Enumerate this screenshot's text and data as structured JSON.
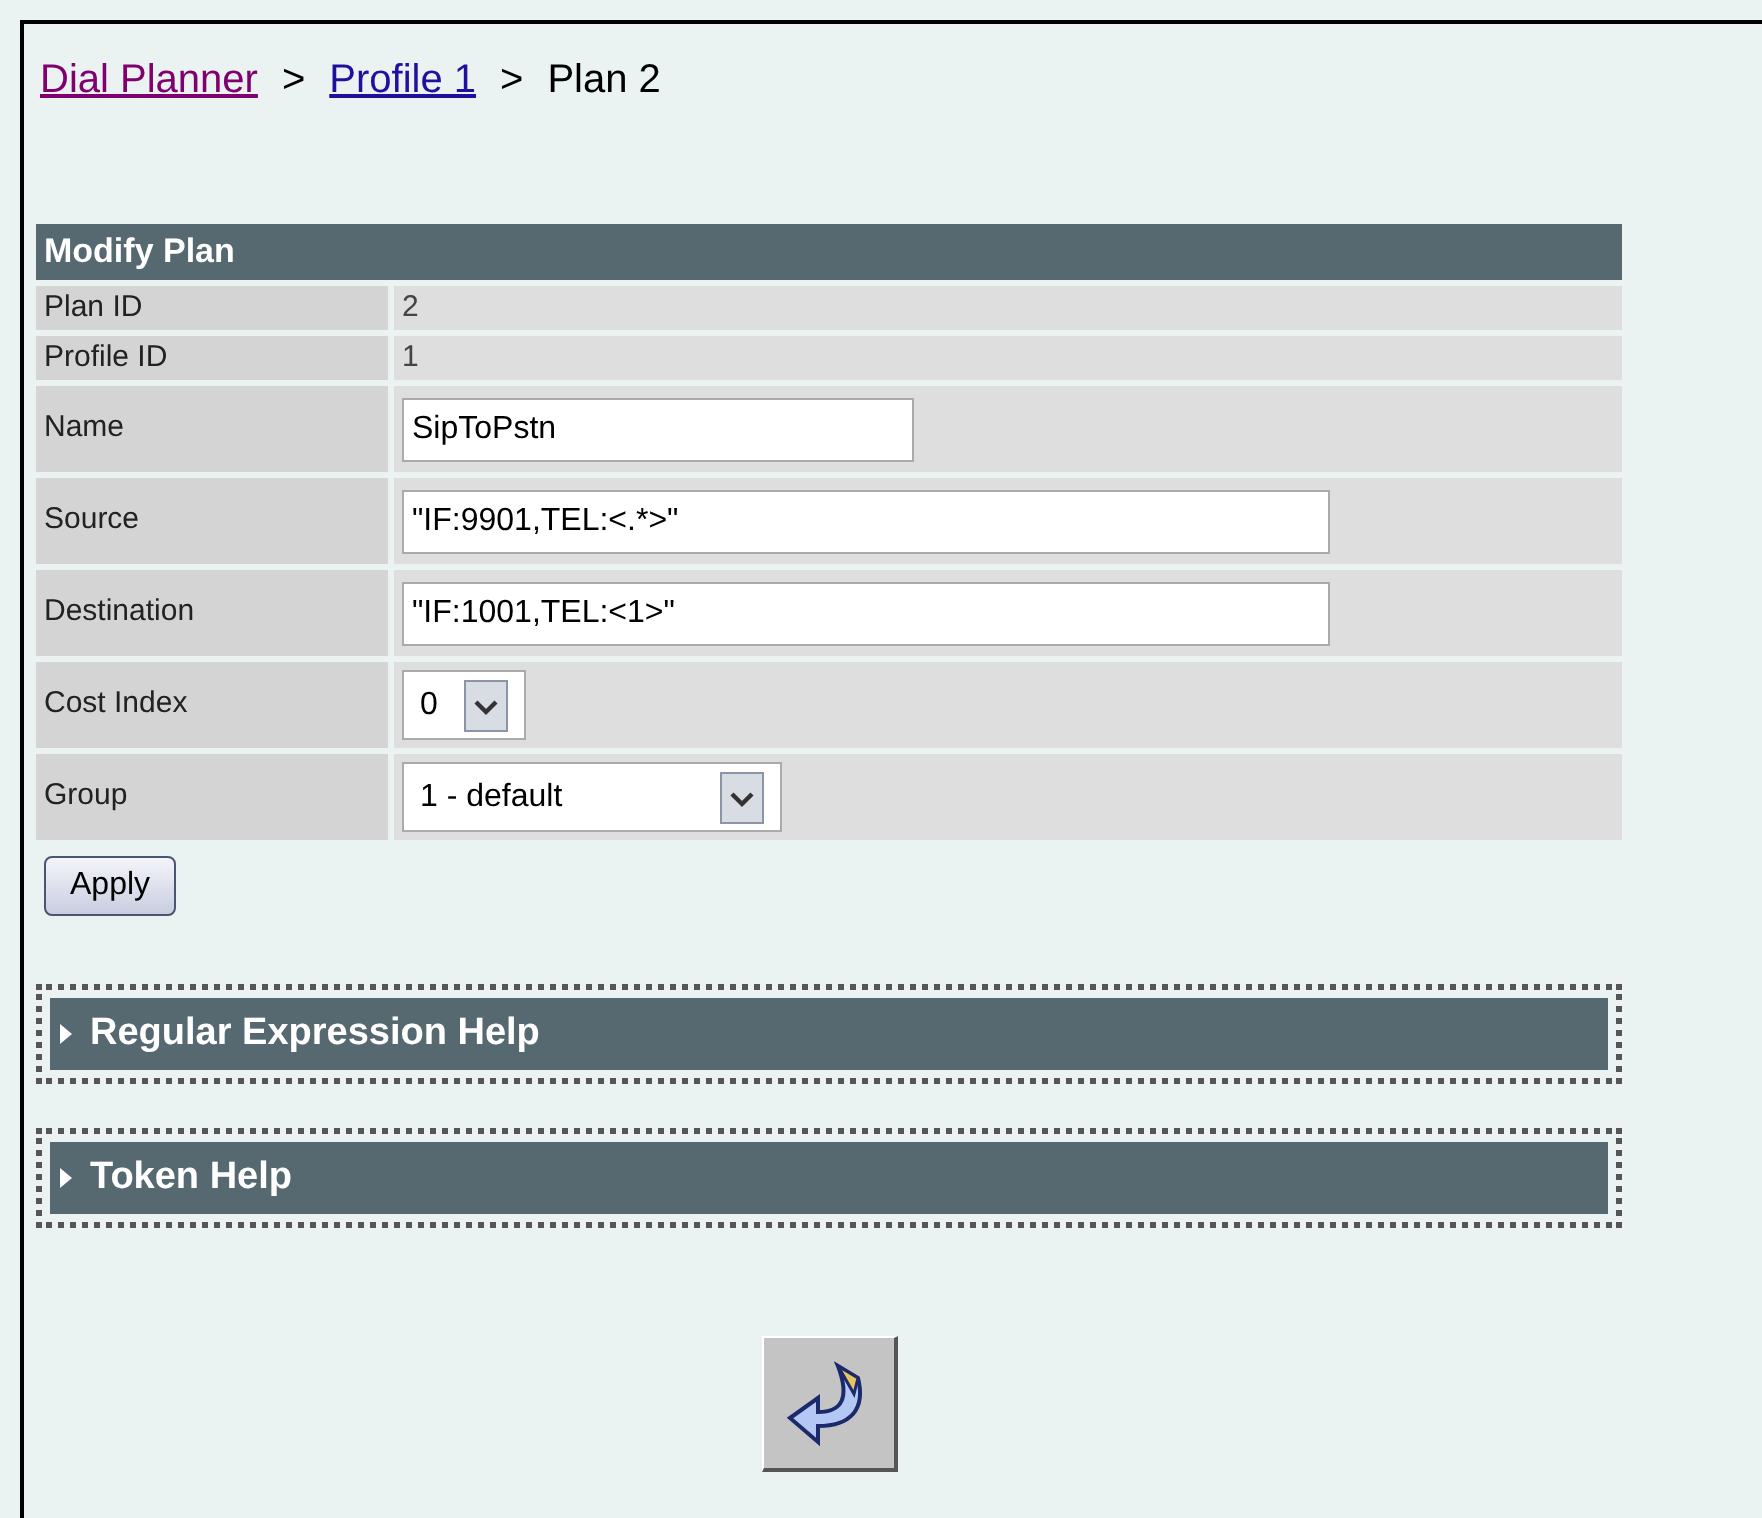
{
  "breadcrumb": [
    {
      "label": "Dial Planner",
      "kind": "link",
      "visited": true
    },
    {
      "label": ">",
      "kind": "separator"
    },
    {
      "label": "Profile 1",
      "kind": "link",
      "visited": false
    },
    {
      "label": ">",
      "kind": "separator"
    },
    {
      "label": "Plan 2",
      "kind": "current"
    }
  ],
  "panel": {
    "title": "Modify Plan",
    "rows": [
      {
        "label": "Plan ID",
        "kind": "text",
        "value": "2"
      },
      {
        "label": "Profile ID",
        "kind": "text",
        "value": "1"
      },
      {
        "label": "Name",
        "kind": "field",
        "value": "SipToPstn"
      },
      {
        "label": "Source",
        "kind": "field",
        "value": "\"IF:9901,TEL:<.*>\""
      },
      {
        "label": "Destination",
        "kind": "field",
        "value": "\"IF:1001,TEL:<1>\""
      },
      {
        "label": "Cost Index",
        "kind": "select",
        "value": "0"
      },
      {
        "label": "Group",
        "kind": "select",
        "value": "1 - default"
      }
    ]
  },
  "apply_button": "Apply",
  "help_sections": [
    {
      "title": "Regular Expression Help",
      "expanded": false
    },
    {
      "title": "Token Help",
      "expanded": false
    }
  ]
}
